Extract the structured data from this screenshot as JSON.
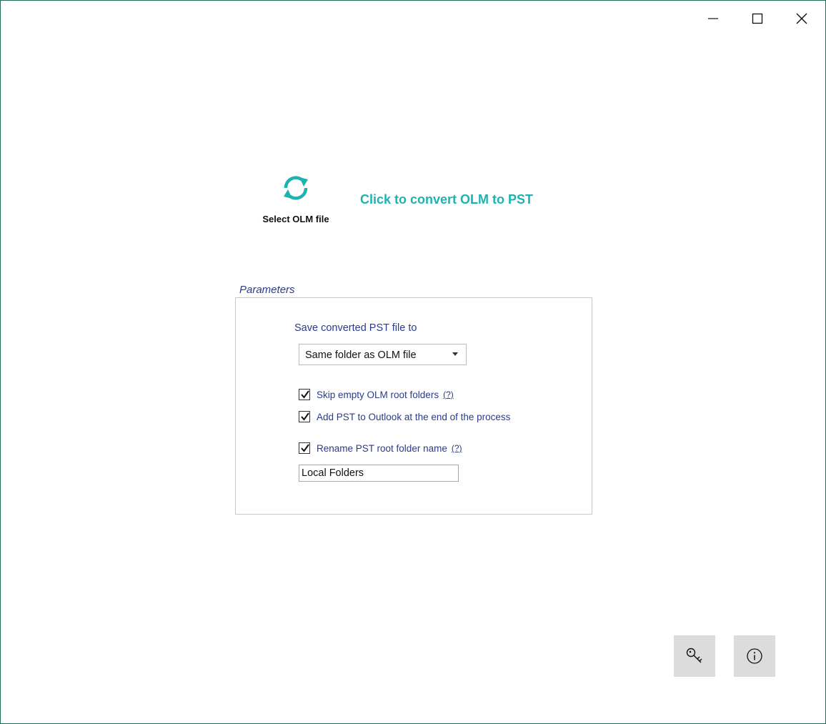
{
  "window_controls": {
    "minimize_icon": "minimize-icon",
    "maximize_icon": "maximize-icon",
    "close_icon": "close-icon"
  },
  "select_olm": {
    "icon": "refresh-icon",
    "label": "Select OLM file"
  },
  "convert_link": "Click to convert OLM to PST",
  "parameters": {
    "legend": "Parameters",
    "save_label": "Save converted PST file to",
    "save_dropdown_value": "Same folder as OLM file",
    "options": [
      {
        "label": "Skip empty OLM root folders",
        "checked": true,
        "help": "(?)"
      },
      {
        "label": "Add PST to Outlook at the end of the process",
        "checked": true,
        "help": ""
      },
      {
        "label": "Rename PST root folder name",
        "checked": true,
        "help": "(?)"
      }
    ],
    "root_folder_name": "Local Folders"
  },
  "bottom_buttons": {
    "license_icon": "key-icon",
    "about_icon": "info-icon"
  },
  "colors": {
    "accent": "#1eb3b0",
    "label_blue": "#2b3a8c",
    "button_bg": "#dcdcdc",
    "border": "#1f6b5a"
  }
}
